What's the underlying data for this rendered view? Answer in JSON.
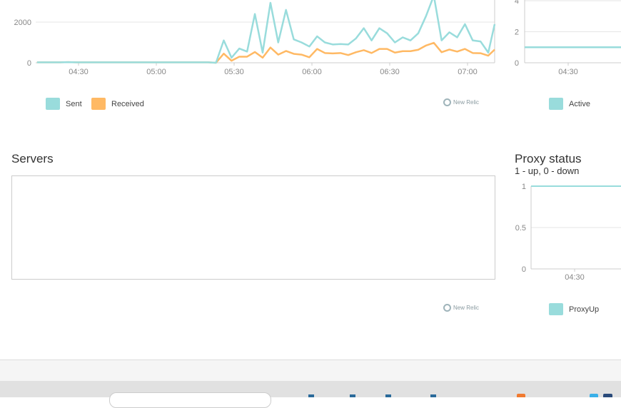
{
  "colors": {
    "sent": "#99dcdc",
    "received": "#ffb964",
    "grid": "#e6e6e6",
    "axis": "#cccccc"
  },
  "traffic_chart": {
    "legend": [
      {
        "label": "Sent",
        "color": "#99dcdc"
      },
      {
        "label": "Received",
        "color": "#ffb964"
      }
    ],
    "attribution": "New Relic"
  },
  "active_chart": {
    "legend": [
      {
        "label": "Active",
        "color": "#99dcdc"
      }
    ]
  },
  "servers": {
    "title": "Servers",
    "attribution": "New Relic"
  },
  "proxy": {
    "title": "Proxy status",
    "subtitle": "1 - up, 0 - down",
    "legend": [
      {
        "label": "ProxyUp",
        "color": "#99dcdc"
      }
    ]
  },
  "chart_data": [
    {
      "type": "line",
      "x_ticks": [
        "04:30",
        "05:00",
        "05:30",
        "06:00",
        "06:30",
        "07:00"
      ],
      "y_ticks": [
        "0",
        "2000"
      ],
      "ylim": [
        0,
        3100
      ],
      "grid": true,
      "legend": "bottom-left",
      "x": [
        "04:14",
        "04:17",
        "04:20",
        "04:23",
        "04:26",
        "04:29",
        "04:32",
        "04:35",
        "04:38",
        "04:41",
        "04:44",
        "04:47",
        "04:50",
        "04:53",
        "04:56",
        "04:59",
        "05:02",
        "05:05",
        "05:08",
        "05:11",
        "05:14",
        "05:17",
        "05:20",
        "05:23",
        "05:26",
        "05:29",
        "05:32",
        "05:35",
        "05:38",
        "05:41",
        "05:44",
        "05:47",
        "05:50",
        "05:53",
        "05:56",
        "05:59",
        "06:02",
        "06:05",
        "06:08",
        "06:11",
        "06:14",
        "06:17",
        "06:20",
        "06:23",
        "06:26",
        "06:29",
        "06:32",
        "06:35",
        "06:38",
        "06:41",
        "06:44",
        "06:47",
        "06:50",
        "06:53",
        "06:56",
        "06:59",
        "07:02",
        "07:05",
        "07:08",
        "07:11"
      ],
      "xlim": [
        "04:13",
        "07:11"
      ],
      "series": [
        {
          "name": "Sent",
          "color": "#99dcdc",
          "values": [
            20,
            20,
            20,
            20,
            30,
            20,
            20,
            20,
            20,
            20,
            20,
            20,
            20,
            20,
            20,
            20,
            20,
            20,
            20,
            20,
            20,
            20,
            20,
            0,
            1100,
            250,
            700,
            550,
            2400,
            500,
            2950,
            1000,
            2600,
            1150,
            1000,
            800,
            1300,
            1000,
            900,
            920,
            900,
            1200,
            1700,
            1100,
            1700,
            1450,
            1000,
            1250,
            1100,
            1450,
            2300,
            3300,
            1100,
            1500,
            1250,
            1900,
            1100,
            1050,
            500,
            1900
          ]
        },
        {
          "name": "Received",
          "color": "#ffb964",
          "values": [
            20,
            20,
            20,
            20,
            30,
            20,
            20,
            20,
            20,
            20,
            20,
            20,
            20,
            20,
            20,
            20,
            20,
            20,
            20,
            20,
            20,
            20,
            20,
            0,
            450,
            100,
            300,
            300,
            530,
            250,
            750,
            400,
            580,
            440,
            400,
            270,
            680,
            480,
            460,
            480,
            380,
            520,
            620,
            480,
            680,
            680,
            500,
            570,
            570,
            640,
            850,
            980,
            520,
            650,
            550,
            680,
            480,
            470,
            350,
            650
          ]
        }
      ]
    },
    {
      "type": "line",
      "x_ticks": [
        "04:30"
      ],
      "y_ticks": [
        "0",
        "2",
        "4"
      ],
      "ylim": [
        0,
        4
      ],
      "grid": true,
      "legend": "bottom-left",
      "series": [
        {
          "name": "Active",
          "color": "#99dcdc",
          "values": [
            1,
            1
          ]
        }
      ]
    },
    {
      "type": "line",
      "title": "Proxy status",
      "subtitle": "1 - up, 0 - down",
      "x_ticks": [
        "04:30"
      ],
      "y_ticks": [
        "0",
        "0.5",
        "1"
      ],
      "ylim": [
        0,
        1
      ],
      "grid": true,
      "legend": "bottom-left",
      "series": [
        {
          "name": "ProxyUp",
          "color": "#99dcdc",
          "values": [
            1,
            1
          ]
        }
      ]
    }
  ]
}
